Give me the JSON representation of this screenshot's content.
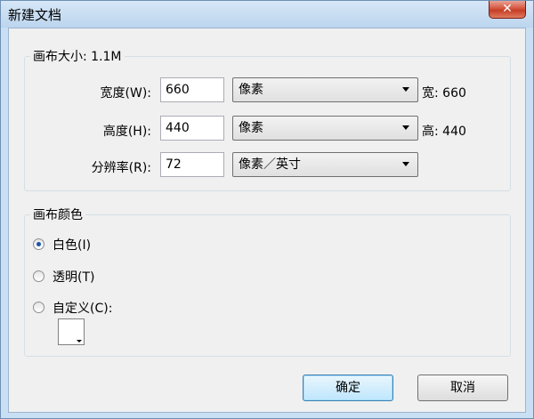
{
  "window": {
    "title": "新建文档",
    "close_label": "✕"
  },
  "canvas_size": {
    "legend": "画布大小: 1.1M",
    "width": {
      "label": "宽度(W):",
      "value": "660",
      "unit": "像素",
      "readout": "宽: 660"
    },
    "height": {
      "label": "高度(H):",
      "value": "440",
      "unit": "像素",
      "readout": "高: 440"
    },
    "resolution": {
      "label": "分辨率(R):",
      "value": "72",
      "unit": "像素／英寸"
    }
  },
  "canvas_color": {
    "legend": "画布颜色",
    "options": [
      {
        "label": "白色(I)",
        "checked": true
      },
      {
        "label": "透明(T)",
        "checked": false
      },
      {
        "label": "自定义(C):",
        "checked": false
      }
    ],
    "custom_color": "#ffffff"
  },
  "buttons": {
    "ok": "确定",
    "cancel": "取消"
  }
}
